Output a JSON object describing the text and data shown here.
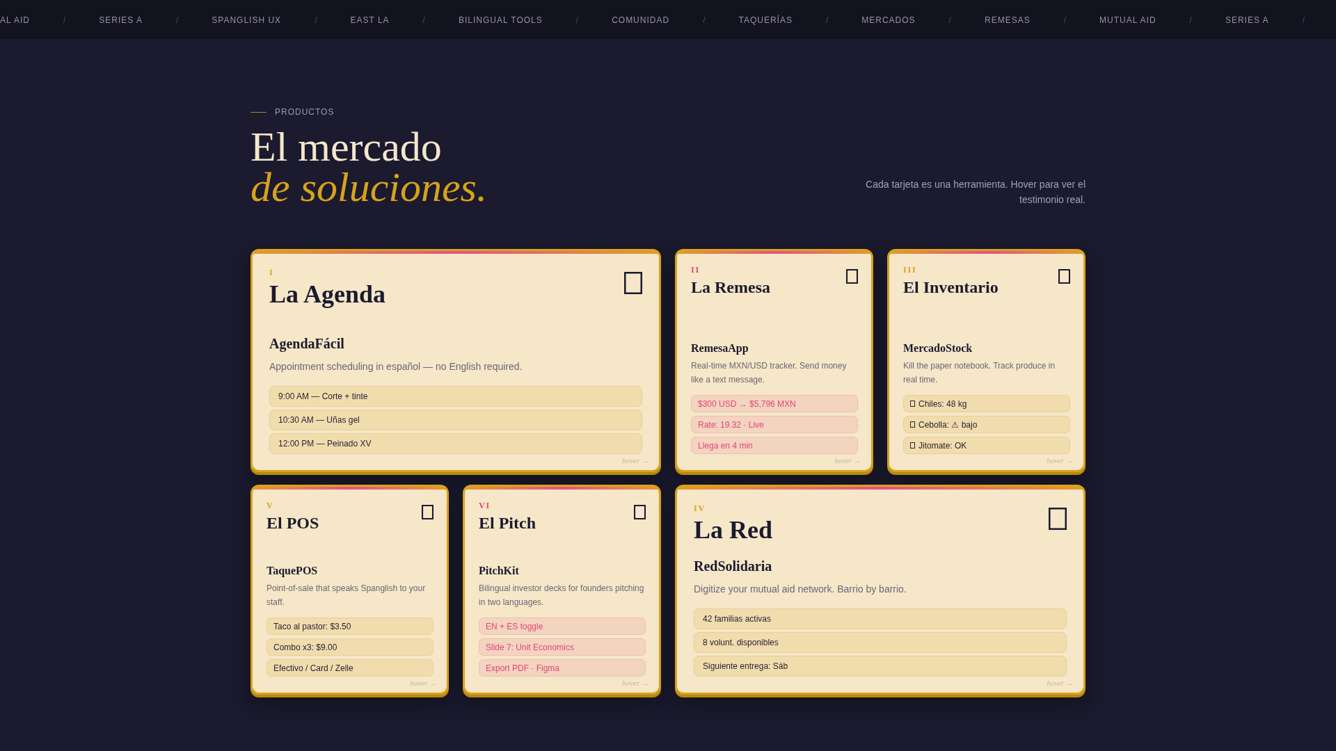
{
  "ticker": [
    {
      "kind": "label",
      "text": "AL AID"
    },
    {
      "kind": "separator",
      "text": "/"
    },
    {
      "kind": "label",
      "text": "SERIES A"
    },
    {
      "kind": "separator",
      "text": "/"
    },
    {
      "kind": "label",
      "text": "SPANGLISH UX"
    },
    {
      "kind": "separator",
      "text": "/"
    },
    {
      "kind": "label",
      "text": "EAST LA"
    },
    {
      "kind": "separator",
      "text": "/"
    },
    {
      "kind": "label",
      "text": "BILINGUAL TOOLS"
    },
    {
      "kind": "separator",
      "text": "/"
    },
    {
      "kind": "label",
      "text": "COMUNIDAD"
    },
    {
      "kind": "separator",
      "text": "/"
    },
    {
      "kind": "label",
      "text": "TAQUERÍAS"
    },
    {
      "kind": "separator",
      "text": "/"
    },
    {
      "kind": "label",
      "text": "MERCADOS"
    },
    {
      "kind": "separator",
      "text": "/"
    },
    {
      "kind": "label",
      "text": "REMESAS"
    },
    {
      "kind": "separator",
      "text": "/"
    },
    {
      "kind": "label",
      "text": "MUTUAL AID"
    },
    {
      "kind": "separator",
      "text": "/"
    },
    {
      "kind": "label",
      "text": "SERIES A"
    },
    {
      "kind": "separator",
      "text": "/"
    }
  ],
  "section": {
    "eyebrow": "PRODUCTOS",
    "title": "El mercado *de soluciones.*",
    "description": "Cada tarjeta es una herramienta. Hover para ver el testimonio real."
  },
  "cards": [
    {
      "kind": "wide",
      "numeral": "I",
      "color": "#d8a31a",
      "title": "La Agenda",
      "product": "AgendaFácil",
      "description": "Appointment scheduling in español — no English required.",
      "chips": [
        {
          "kind": "plain",
          "text": "9:00 AM — Corte + tinte"
        },
        {
          "kind": "plain",
          "text": "10:30 AM — Uñas gel"
        },
        {
          "kind": "plain",
          "text": "12:00 PM — Peinado XV"
        }
      ],
      "hint": "hover →"
    },
    {
      "kind": "compact",
      "numeral": "II",
      "color": "#e3457c",
      "title": "La Remesa",
      "product": "RemesaApp",
      "description": "Real-time MXN/USD tracker. Send money like a text message.",
      "chips": [
        {
          "kind": "accent",
          "text": "$300 USD → $5,796 MXN"
        },
        {
          "kind": "accent",
          "text": "Rate: 19.32 · Live"
        },
        {
          "kind": "accent",
          "text": "Llega en 4 min"
        }
      ],
      "hint": "hover →"
    },
    {
      "kind": "compact",
      "numeral": "III",
      "color": "#d8a31a",
      "title": "El Inventario",
      "product": "MercadoStock",
      "description": "Kill the paper notebook. Track produce in real time.",
      "chips": [
        {
          "kind": "glyph",
          "text": "Chiles: 48 kg"
        },
        {
          "kind": "glyph",
          "text": "Cebolla: ⚠ bajo"
        },
        {
          "kind": "glyph",
          "text": "Jitomate: OK"
        }
      ],
      "hint": "hover →"
    },
    {
      "kind": "compact",
      "numeral": "V",
      "color": "#d8a31a",
      "title": "El POS",
      "product": "TaquePOS",
      "description": "Point-of-sale that speaks Spanglish to your staff.",
      "chips": [
        {
          "kind": "plain",
          "text": "Taco al pastor: $3.50"
        },
        {
          "kind": "plain",
          "text": "Combo x3: $9.00"
        },
        {
          "kind": "plain",
          "text": "Efectivo / Card / Zelle"
        }
      ],
      "hint": "hover →"
    },
    {
      "kind": "compact",
      "numeral": "VI",
      "color": "#e3457c",
      "title": "El Pitch",
      "product": "PitchKit",
      "description": "Bilingual investor decks for founders pitching in two languages.",
      "chips": [
        {
          "kind": "accent",
          "text": "EN + ES toggle"
        },
        {
          "kind": "accent",
          "text": "Slide 7: Unit Economics"
        },
        {
          "kind": "accent",
          "text": "Export PDF · Figma"
        }
      ],
      "hint": "hover →"
    },
    {
      "kind": "wide",
      "numeral": "IV",
      "color": "#d8a31a",
      "title": "La Red",
      "product": "RedSolidaria",
      "description": "Digitize your mutual aid network. Barrio by barrio.",
      "chips": [
        {
          "kind": "plain",
          "text": "42 familias activas"
        },
        {
          "kind": "plain",
          "text": "8 volunt. disponibles"
        },
        {
          "kind": "plain",
          "text": "Siguiente entrega: Sáb"
        }
      ],
      "hint": "hover →"
    }
  ]
}
